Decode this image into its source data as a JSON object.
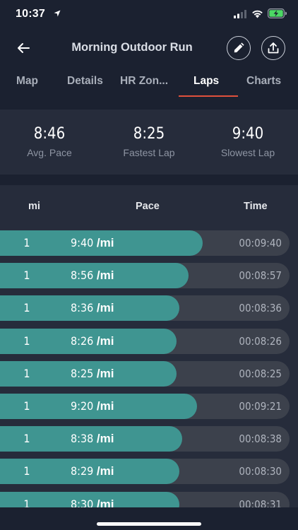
{
  "status_bar": {
    "time": "10:37"
  },
  "nav": {
    "title": "Morning Outdoor Run"
  },
  "tabs": [
    {
      "label": "Map",
      "active": false
    },
    {
      "label": "Details",
      "active": false
    },
    {
      "label": "HR Zon...",
      "active": false
    },
    {
      "label": "Laps",
      "active": true
    },
    {
      "label": "Charts",
      "active": false
    }
  ],
  "summary": {
    "avg_pace": {
      "value": "8:46",
      "label": "Avg. Pace"
    },
    "fastest_lap": {
      "value": "8:25",
      "label": "Fastest Lap"
    },
    "slowest_lap": {
      "value": "9:40",
      "label": "Slowest Lap"
    }
  },
  "laps_table": {
    "headers": {
      "mi": "mi",
      "pace": "Pace",
      "time": "Time"
    },
    "unit": "/mi",
    "rows": [
      {
        "mi": "1",
        "pace": "9:40",
        "time": "00:09:40",
        "fill": 0.7
      },
      {
        "mi": "1",
        "pace": "8:56",
        "time": "00:08:57",
        "fill": 0.65
      },
      {
        "mi": "1",
        "pace": "8:36",
        "time": "00:08:36",
        "fill": 0.62
      },
      {
        "mi": "1",
        "pace": "8:26",
        "time": "00:08:26",
        "fill": 0.61
      },
      {
        "mi": "1",
        "pace": "8:25",
        "time": "00:08:25",
        "fill": 0.61
      },
      {
        "mi": "1",
        "pace": "9:20",
        "time": "00:09:21",
        "fill": 0.68
      },
      {
        "mi": "1",
        "pace": "8:38",
        "time": "00:08:38",
        "fill": 0.63
      },
      {
        "mi": "1",
        "pace": "8:29",
        "time": "00:08:30",
        "fill": 0.62
      },
      {
        "mi": "1",
        "pace": "8:30",
        "time": "00:08:31",
        "fill": 0.62
      }
    ]
  },
  "colors": {
    "background": "#1b2130",
    "panel": "#262c3b",
    "bar_fill": "#3f9591",
    "bar_track": "#3c414c",
    "tab_accent": "#e0513c"
  },
  "icons": {
    "location": "location-arrow-icon",
    "signal": "cellular-signal-icon",
    "wifi": "wifi-icon",
    "battery": "battery-charging-icon",
    "back": "back-arrow-icon",
    "edit": "pencil-icon",
    "share": "upload-icon"
  }
}
